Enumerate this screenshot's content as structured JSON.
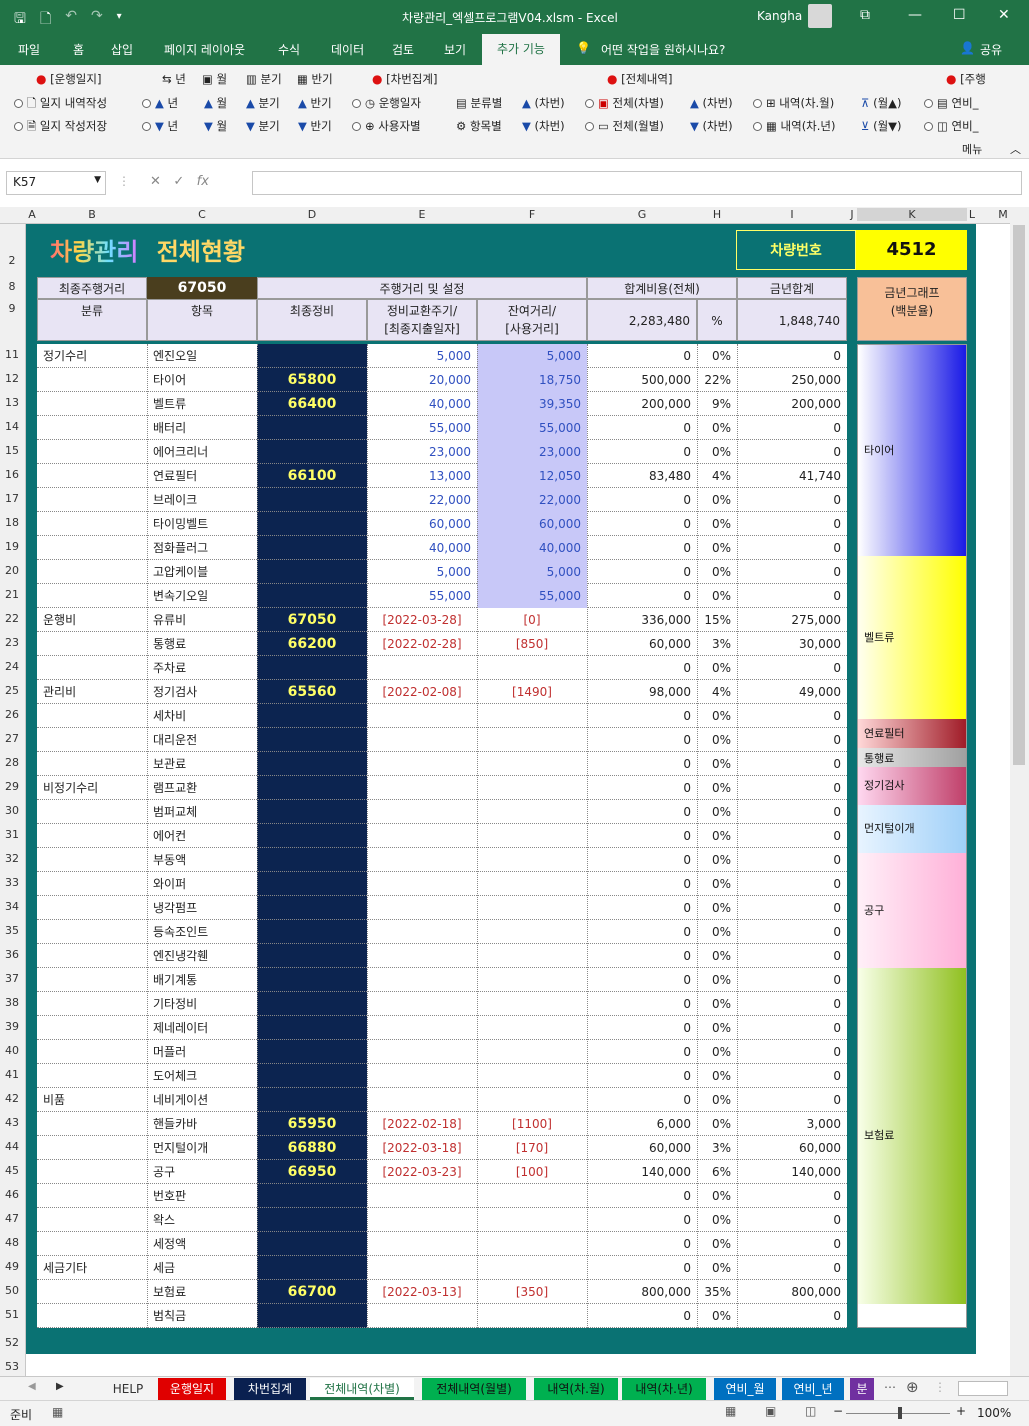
{
  "window": {
    "title": "차량관리_엑셀프로그램V04.xlsm  -  Excel",
    "user": "Kangha"
  },
  "menu": [
    "파일",
    "홈",
    "삽입",
    "페이지 레이아웃",
    "수식",
    "데이터",
    "검토",
    "보기",
    "추가 기능",
    "어떤 작업을 원하시나요?",
    "공유"
  ],
  "ribbon": {
    "groups": [
      "[운행일지]",
      "[차번집계]",
      "[전체내역]",
      "[주행"
    ],
    "row1": [
      "년",
      "월",
      "분기",
      "반기"
    ],
    "row2": [
      "일지 내역작성",
      "년",
      "월",
      "분기",
      "반기",
      "운행일자",
      "분류별",
      "(차번)",
      "전체(차별)",
      "(차번)",
      "내역(차.월)",
      "(월▲)",
      "연비_"
    ],
    "row3": [
      "일지 작성저장",
      "년",
      "월",
      "분기",
      "반기",
      "사용자별",
      "항목별",
      "(차번)",
      "전체(월별)",
      "(차번)",
      "내역(차.년)",
      "(월▼)",
      "연비_"
    ],
    "menu_label": "메뉴"
  },
  "namebox": "K57",
  "fx": "fx",
  "columns": [
    "A",
    "B",
    "C",
    "D",
    "E",
    "F",
    "G",
    "H",
    "I",
    "J",
    "K",
    "L",
    "M"
  ],
  "rows": [
    "2",
    "8",
    "9",
    "11",
    "12",
    "13",
    "14",
    "15",
    "16",
    "17",
    "18",
    "19",
    "20",
    "21",
    "22",
    "23",
    "24",
    "25",
    "26",
    "27",
    "28",
    "29",
    "30",
    "31",
    "32",
    "33",
    "34",
    "35",
    "36",
    "37",
    "38",
    "39",
    "40",
    "41",
    "42",
    "43",
    "44",
    "45",
    "46",
    "47",
    "48",
    "49",
    "50",
    "51",
    "52",
    "53"
  ],
  "header": {
    "title1": "차량관리",
    "title2": "전체현황",
    "car_label": "차량번호",
    "car_no": "4512",
    "last_dist_label": "최종주행거리",
    "last_dist": "67050",
    "dist_setting": "주행거리 및 설정",
    "total_cost": "합계비용(전체)",
    "year_total": "금년합계",
    "graph_title": "금년그래프\n(백분율)",
    "col_cat": "분류",
    "col_item": "항목",
    "col_last": "최종정비",
    "col_cycle": "정비교환주기/\n[최종지출일자]",
    "col_remain": "잔여거리/\n[사용거리]",
    "sum_total": "2,283,480",
    "pct": "%",
    "sum_year": "1,848,740"
  },
  "table": [
    [
      "정기수리",
      "엔진오일",
      "",
      "5,000",
      "5,000",
      "0",
      "0%",
      "0"
    ],
    [
      "",
      "타이어",
      "65800",
      "20,000",
      "18,750",
      "500,000",
      "22%",
      "250,000"
    ],
    [
      "",
      "벨트류",
      "66400",
      "40,000",
      "39,350",
      "200,000",
      "9%",
      "200,000"
    ],
    [
      "",
      "배터리",
      "",
      "55,000",
      "55,000",
      "0",
      "0%",
      "0"
    ],
    [
      "",
      "에어크리너",
      "",
      "23,000",
      "23,000",
      "0",
      "0%",
      "0"
    ],
    [
      "",
      "연료필터",
      "66100",
      "13,000",
      "12,050",
      "83,480",
      "4%",
      "41,740"
    ],
    [
      "",
      "브레이크",
      "",
      "22,000",
      "22,000",
      "0",
      "0%",
      "0"
    ],
    [
      "",
      "타이밍벨트",
      "",
      "60,000",
      "60,000",
      "0",
      "0%",
      "0"
    ],
    [
      "",
      "점화플러그",
      "",
      "40,000",
      "40,000",
      "0",
      "0%",
      "0"
    ],
    [
      "",
      "고압케이블",
      "",
      "5,000",
      "5,000",
      "0",
      "0%",
      "0"
    ],
    [
      "",
      "변속기오일",
      "",
      "55,000",
      "55,000",
      "0",
      "0%",
      "0"
    ],
    [
      "운행비",
      "유류비",
      "67050",
      "[2022-03-28]",
      "[0]",
      "336,000",
      "15%",
      "275,000"
    ],
    [
      "",
      "통행료",
      "66200",
      "[2022-02-28]",
      "[850]",
      "60,000",
      "3%",
      "30,000"
    ],
    [
      "",
      "주차료",
      "",
      "",
      "",
      "0",
      "0%",
      "0"
    ],
    [
      "관리비",
      "정기검사",
      "65560",
      "[2022-02-08]",
      "[1490]",
      "98,000",
      "4%",
      "49,000"
    ],
    [
      "",
      "세차비",
      "",
      "",
      "",
      "0",
      "0%",
      "0"
    ],
    [
      "",
      "대리운전",
      "",
      "",
      "",
      "0",
      "0%",
      "0"
    ],
    [
      "",
      "보관료",
      "",
      "",
      "",
      "0",
      "0%",
      "0"
    ],
    [
      "비정기수리",
      "램프교환",
      "",
      "",
      "",
      "0",
      "0%",
      "0"
    ],
    [
      "",
      "범퍼교체",
      "",
      "",
      "",
      "0",
      "0%",
      "0"
    ],
    [
      "",
      "에어컨",
      "",
      "",
      "",
      "0",
      "0%",
      "0"
    ],
    [
      "",
      "부동액",
      "",
      "",
      "",
      "0",
      "0%",
      "0"
    ],
    [
      "",
      "와이퍼",
      "",
      "",
      "",
      "0",
      "0%",
      "0"
    ],
    [
      "",
      "냉각펌프",
      "",
      "",
      "",
      "0",
      "0%",
      "0"
    ],
    [
      "",
      "등속조인트",
      "",
      "",
      "",
      "0",
      "0%",
      "0"
    ],
    [
      "",
      "엔진냉각휀",
      "",
      "",
      "",
      "0",
      "0%",
      "0"
    ],
    [
      "",
      "배기계통",
      "",
      "",
      "",
      "0",
      "0%",
      "0"
    ],
    [
      "",
      "기타정비",
      "",
      "",
      "",
      "0",
      "0%",
      "0"
    ],
    [
      "",
      "제네레이터",
      "",
      "",
      "",
      "0",
      "0%",
      "0"
    ],
    [
      "",
      "머플러",
      "",
      "",
      "",
      "0",
      "0%",
      "0"
    ],
    [
      "",
      "도어체크",
      "",
      "",
      "",
      "0",
      "0%",
      "0"
    ],
    [
      "비품",
      "네비게이션",
      "",
      "",
      "",
      "0",
      "0%",
      "0"
    ],
    [
      "",
      "핸들카바",
      "65950",
      "[2022-02-18]",
      "[1100]",
      "6,000",
      "0%",
      "3,000"
    ],
    [
      "",
      "먼지털이개",
      "66880",
      "[2022-03-18]",
      "[170]",
      "60,000",
      "3%",
      "60,000"
    ],
    [
      "",
      "공구",
      "66950",
      "[2022-03-23]",
      "[100]",
      "140,000",
      "6%",
      "140,000"
    ],
    [
      "",
      "번호판",
      "",
      "",
      "",
      "0",
      "0%",
      "0"
    ],
    [
      "",
      "왁스",
      "",
      "",
      "",
      "0",
      "0%",
      "0"
    ],
    [
      "",
      "세정액",
      "",
      "",
      "",
      "0",
      "0%",
      "0"
    ],
    [
      "세금기타",
      "세금",
      "",
      "",
      "",
      "0",
      "0%",
      "0"
    ],
    [
      "",
      "보험료",
      "66700",
      "[2022-03-13]",
      "[350]",
      "800,000",
      "35%",
      "800,000"
    ],
    [
      "",
      "범칙금",
      "",
      "",
      "",
      "0",
      "0%",
      "0"
    ]
  ],
  "graph": [
    {
      "label": "타이어",
      "pct": 22,
      "c1": "#ffffff",
      "c2": "#1a1ae6"
    },
    {
      "label": "벨트류",
      "pct": 17,
      "c1": "#fffff0",
      "c2": "#ffff00"
    },
    {
      "label": "연료필터",
      "pct": 3,
      "c1": "#ffd8d8",
      "c2": "#a01c28"
    },
    {
      "label": "통행료",
      "pct": 2,
      "c1": "#e8e8e8",
      "c2": "#a0a0a0"
    },
    {
      "label": "정기검사",
      "pct": 4,
      "c1": "#ffd8f0",
      "c2": "#c0406a"
    },
    {
      "label": "먼지털이개",
      "pct": 5,
      "c1": "#e8f4ff",
      "c2": "#a0d0f8"
    },
    {
      "label": "공구",
      "pct": 12,
      "c1": "#fff0f8",
      "c2": "#ffb0d8"
    },
    {
      "label": "보험료",
      "pct": 35,
      "c1": "#f8ffe8",
      "c2": "#90c020"
    }
  ],
  "sheet_tabs": [
    {
      "label": "HELP",
      "bg": "#f3f3f3",
      "fg": "#333"
    },
    {
      "label": "운행일지",
      "bg": "#e00000",
      "fg": "#fff"
    },
    {
      "label": "차번집계",
      "bg": "#0a2050",
      "fg": "#fff"
    },
    {
      "label": "전체내역(차별)",
      "bg": "#ffffff",
      "fg": "#217346"
    },
    {
      "label": "전체내역(월별)",
      "bg": "#00b050",
      "fg": "#111"
    },
    {
      "label": "내역(차.월)",
      "bg": "#00b050",
      "fg": "#111"
    },
    {
      "label": "내역(차.년)",
      "bg": "#00b050",
      "fg": "#111"
    },
    {
      "label": "연비_월",
      "bg": "#0070c0",
      "fg": "#fff"
    },
    {
      "label": "연비_년",
      "bg": "#0070c0",
      "fg": "#fff"
    },
    {
      "label": "분",
      "bg": "#7030a0",
      "fg": "#fff"
    }
  ],
  "status": {
    "ready": "준비",
    "zoom": "100%"
  }
}
